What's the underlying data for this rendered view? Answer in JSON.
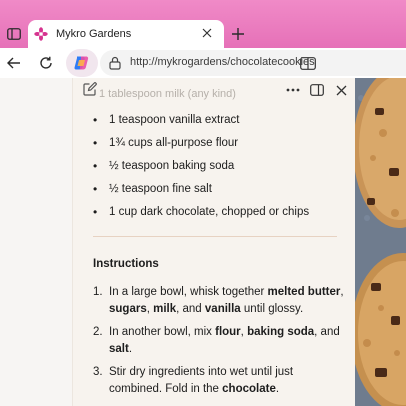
{
  "browser": {
    "tab": {
      "title": "Mykro Gardens"
    },
    "new_tab_label": "+",
    "address": {
      "url": "http://mykrogardens/chocolatecookies"
    }
  },
  "panel": {
    "faded_line": "1 tablespoon milk (any kind)",
    "ingredients": [
      "1 teaspoon vanilla extract",
      "1¾ cups all-purpose flour",
      "½ teaspoon baking soda",
      "½ teaspoon fine salt",
      "1 cup dark chocolate, chopped or chips"
    ],
    "instructions_title": "Instructions",
    "steps": [
      {
        "num": "1.",
        "parts": [
          {
            "t": "In a large bowl, whisk together ",
            "b": false
          },
          {
            "t": "melted butter",
            "b": true
          },
          {
            "t": ", ",
            "b": false
          },
          {
            "t": "sugars",
            "b": true
          },
          {
            "t": ", ",
            "b": false
          },
          {
            "t": "milk",
            "b": true
          },
          {
            "t": ", and ",
            "b": false
          },
          {
            "t": "vanilla",
            "b": true
          },
          {
            "t": " until glossy.",
            "b": false
          }
        ]
      },
      {
        "num": "2.",
        "parts": [
          {
            "t": "In another bowl, mix ",
            "b": false
          },
          {
            "t": "flour",
            "b": true
          },
          {
            "t": ", ",
            "b": false
          },
          {
            "t": "baking soda",
            "b": true
          },
          {
            "t": ", and ",
            "b": false
          },
          {
            "t": "salt",
            "b": true
          },
          {
            "t": ".",
            "b": false
          }
        ]
      },
      {
        "num": "3.",
        "parts": [
          {
            "t": "Stir dry ingredients into wet until just combined. Fold in the ",
            "b": false
          },
          {
            "t": "chocolate",
            "b": true
          },
          {
            "t": ".",
            "b": false
          }
        ]
      }
    ]
  },
  "colors": {
    "tab_strip": "#e671b8",
    "panel_bg": "#f7f3ee",
    "copilot_accent": "#7b61ff"
  },
  "icons": {
    "sidebar": "sidebar-icon",
    "favicon": "flower-icon",
    "close": "close-icon",
    "back": "back-arrow-icon",
    "refresh": "refresh-icon",
    "copilot": "copilot-icon",
    "lock": "lock-icon",
    "reader": "reader-mode-icon",
    "edit": "edit-icon",
    "more": "more-icon",
    "split": "split-view-icon"
  }
}
